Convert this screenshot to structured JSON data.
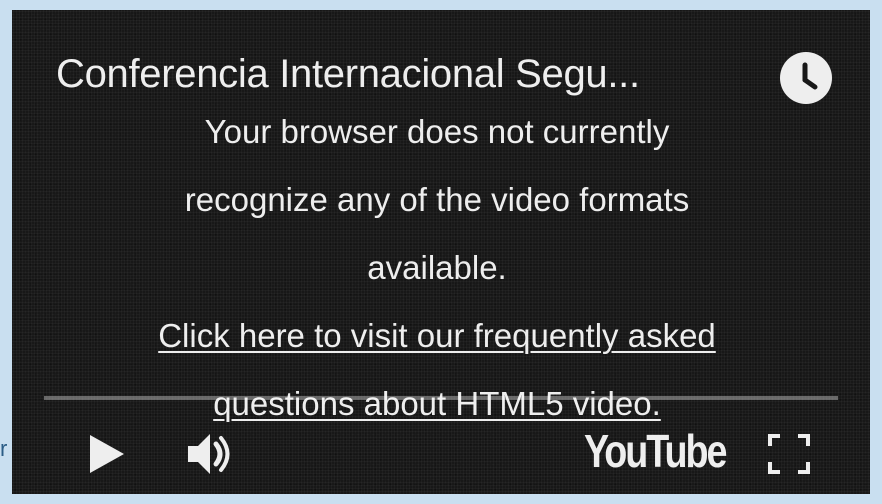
{
  "page": {
    "stray_text": "r"
  },
  "player": {
    "title": "Conferencia Internacional Segu...",
    "message": {
      "line1": "Your browser does not currently",
      "line2": "recognize any of the video formats",
      "line3": "available.",
      "link_line1": "Click here to visit our frequently asked",
      "link_line2": "questions about HTML5 video."
    },
    "progress": 0,
    "controls": {
      "play_icon": "play-icon",
      "volume_icon": "volume-icon",
      "logo_text": "YouTube",
      "fullscreen_icon": "fullscreen-icon",
      "watch_later_icon": "clock-icon"
    }
  },
  "colors": {
    "background": "#c9dff0",
    "player_bg": "#181818",
    "foreground": "#eeeeee",
    "stray_text": "#2b5d86"
  }
}
